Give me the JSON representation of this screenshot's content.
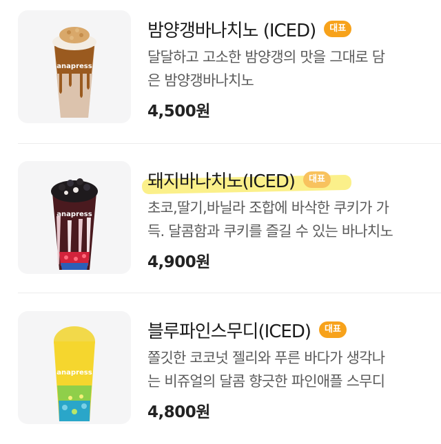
{
  "menu": {
    "items": [
      {
        "name": "밤양갱바나치노 (ICED)",
        "badge": "대표",
        "description_lines": [
          "달달하고 고소한 밤양갱의 맛을 그대로 담",
          "은 밤양갱바나치노"
        ],
        "price": "4,500원",
        "image_icon": "chestnut-bananacino-drink-image",
        "cup_brand": "anapress"
      },
      {
        "name": "돼지바나치노(ICED)",
        "badge": "대표",
        "description_lines": [
          "초코,딸기,바닐라 조합에 바삭한 쿠키가 가",
          "득. 달콤함과 쿠키를 즐길 수 있는 바나치노"
        ],
        "price": "4,900원",
        "image_icon": "pig-bananacino-drink-image",
        "cup_brand": "anapress",
        "highlighted": true
      },
      {
        "name": "블루파인스무디(ICED)",
        "badge": "대표",
        "description_lines": [
          "쫄깃한 코코넛 젤리와 푸른 바다가 생각나",
          "는 비쥬얼의 달콤 향긋한 파인애플 스무디"
        ],
        "price": "4,800원",
        "image_icon": "blue-pine-smoothie-image",
        "cup_brand": "anapress"
      }
    ]
  },
  "colors": {
    "badge": "#f7a21b",
    "highlight": "#fbf08a",
    "thumb_bg": "#f5f5f6"
  }
}
